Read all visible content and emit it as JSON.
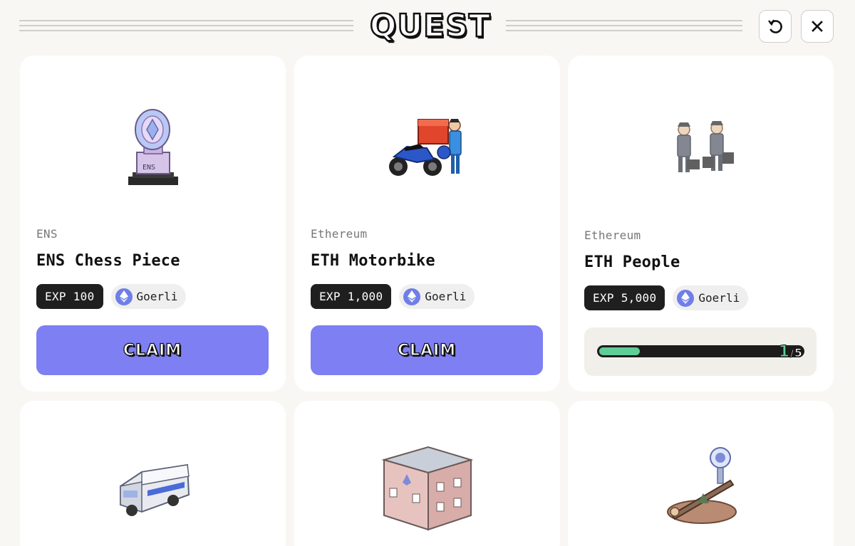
{
  "header": {
    "logo_text": "QUEST",
    "refresh_label": "Refresh",
    "close_label": "Close"
  },
  "colors": {
    "page_bg": "#f8f7f3",
    "claim_button": "#7d7ff2",
    "progress_fill": "#5fcd98",
    "exp_badge": "#1f1f1f",
    "eth_icon": "#6f7ee8"
  },
  "claim_label": "CLAIM",
  "quests": [
    {
      "icon": "ens-chess-piece-icon",
      "chain": "ENS",
      "title": "ENS Chess Piece",
      "exp": "EXP 100",
      "network": "Goerli",
      "network_icon": "ethereum-icon",
      "status": "claim"
    },
    {
      "icon": "eth-motorbike-icon",
      "chain": "Ethereum",
      "title": "ETH Motorbike",
      "exp": "EXP 1,000",
      "network": "Goerli",
      "network_icon": "ethereum-icon",
      "status": "claim"
    },
    {
      "icon": "eth-people-icon",
      "chain": "Ethereum",
      "title": "ETH People",
      "exp": "EXP 5,000",
      "network": "Goerli",
      "network_icon": "ethereum-icon",
      "status": "in-progress",
      "progress": {
        "current": "1",
        "separator": "/",
        "total": "5",
        "fraction": 0.2
      }
    },
    {
      "icon": "armored-truck-icon"
    },
    {
      "icon": "ethereum-building-icon"
    },
    {
      "icon": "seesaw-icon"
    }
  ]
}
